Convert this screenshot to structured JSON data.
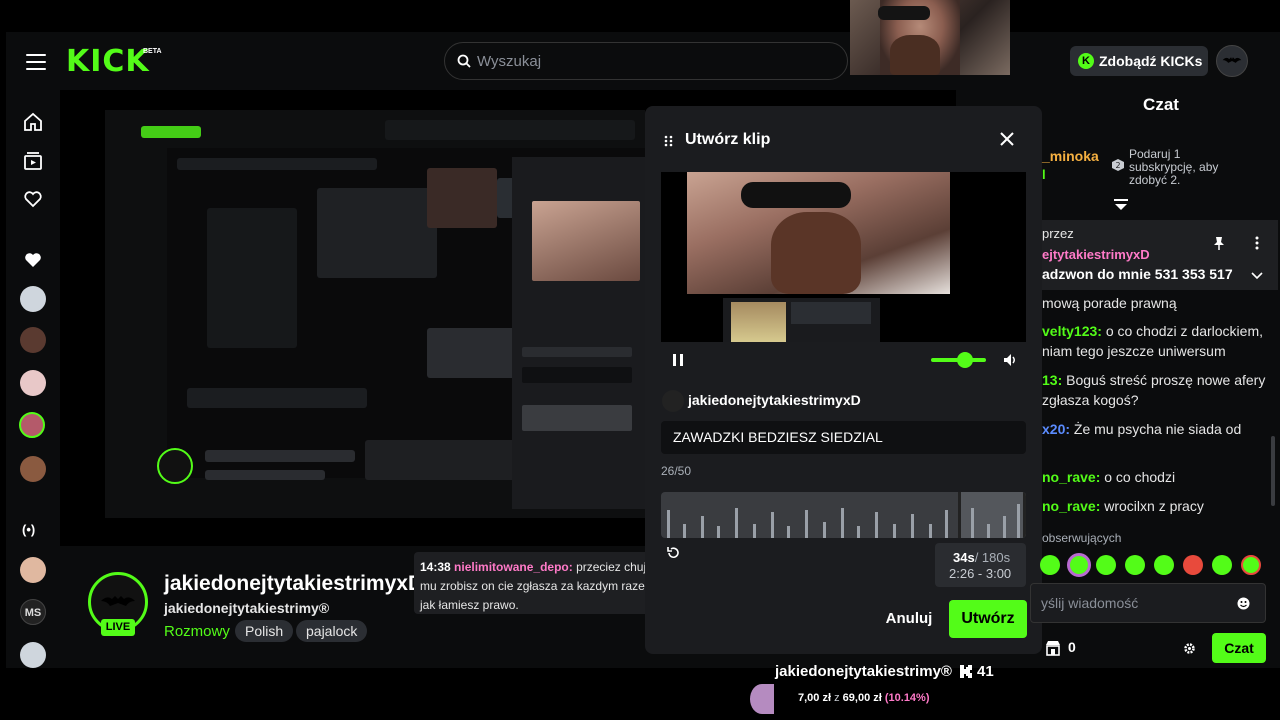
{
  "header": {
    "logo_text": "KICK",
    "logo_badge": "BETA",
    "search_placeholder": "Wyszukaj",
    "kicks_button": "Zdobądź KICKs"
  },
  "stream": {
    "channel_name": "jakiedonejtytakiestrimyxD",
    "channel_subtitle": "jakiedonejtytakiestrimy®",
    "category": "Rozmowy",
    "tags": [
      "Polish",
      "pajalock"
    ],
    "live_label": "LIVE"
  },
  "tooltip": {
    "time": "14:38",
    "user": "nielimitowane_depo:",
    "text": "przeciez chuja mu zrobisz on cie zgłasza za kazdym razem jak łamiesz prawo."
  },
  "clip_modal": {
    "title": "Utwórz klip",
    "streamer": "jakiedonejtytakiestrimyxD",
    "clip_title": "ZAWADZKI BEDZIESZ SIEDZIAL",
    "char_count": "26/50",
    "duration_selected": "34s",
    "duration_max": "/ 180s",
    "range": "2:26 - 3:00",
    "cancel_label": "Anuluj",
    "create_label": "Utwórz",
    "volume_level": 0.6
  },
  "chat": {
    "title": "Czat",
    "gift_user": "_minoka",
    "gift_user_suffix": "l",
    "gift_text": "Podaruj 1 subskrypcję, aby zdobyć 2.",
    "pinned_by": "przez",
    "pinned_user": "ejtytakiestrimyxD",
    "pinned_message": "adzwon do mnie 531 353 517",
    "messages": [
      {
        "user": "",
        "text": "mową porade prawną",
        "color": "#e6e6e6"
      },
      {
        "user": "velty123:",
        "text": "o co chodzi z darlockiem,",
        "color": "#53fc18"
      },
      {
        "user": "",
        "text": "niam tego jeszcze uniwersum",
        "color": "#e6e6e6"
      },
      {
        "user": "13:",
        "text": "Boguś streść proszę nowe afery",
        "color": "#53fc18"
      },
      {
        "user": "",
        "text": "zgłasza kogoś?",
        "color": "#e6e6e6"
      },
      {
        "user": "x20:",
        "text": "Że mu psycha nie siada od",
        "color": "#5b8cff"
      },
      {
        "user": "no_rave:",
        "text": "o co chodzi",
        "color": "#53fc18"
      },
      {
        "user": "no_rave:",
        "text": "wrocilxn z pracy",
        "color": "#53fc18"
      }
    ],
    "followers_label": "obserwujących",
    "input_placeholder": "yślij wiadomość",
    "kicks_count": "0",
    "chat_button": "Czat"
  },
  "bottom_overlay": {
    "name": "jakiedonejtytakiestrimy®",
    "count": "41",
    "goal_current": "7,00 zł",
    "goal_sep": "z",
    "goal_total": "69,00 zł",
    "goal_pct": "(10.14%)"
  },
  "colors": {
    "brand": "#53fc18",
    "background": "#0b0c0d",
    "panel": "#1b1c1f",
    "username_pink": "#ff7ac8"
  }
}
